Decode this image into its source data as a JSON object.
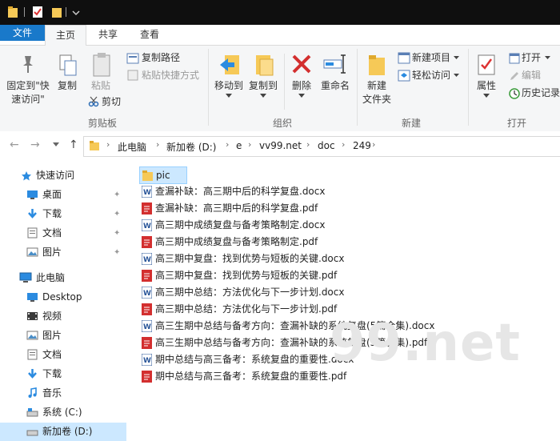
{
  "tabs": {
    "file": "文件",
    "home": "主页",
    "share": "共享",
    "view": "查看"
  },
  "ribbon": {
    "clipboard": {
      "pin_line1": "固定到\"快",
      "pin_line2": "速访问\"",
      "copy": "复制",
      "paste": "粘贴",
      "copy_path": "复制路径",
      "paste_shortcut": "粘贴快捷方式",
      "cut": "剪切",
      "label": "剪贴板"
    },
    "organize": {
      "move_to": "移动到",
      "copy_to": "复制到",
      "delete": "删除",
      "rename": "重命名",
      "label": "组织"
    },
    "new": {
      "new_folder_line1": "新建",
      "new_folder_line2": "文件夹",
      "new_item": "新建项目",
      "easy_access": "轻松访问",
      "label": "新建"
    },
    "open": {
      "properties": "属性",
      "open": "打开",
      "edit": "编辑",
      "history": "历史记录",
      "label": "打开"
    }
  },
  "breadcrumb": [
    "此电脑",
    "新加卷 (D:)",
    "e",
    "vv99.net",
    "doc",
    "249"
  ],
  "nav": {
    "quick_access": "快速访问",
    "items": [
      {
        "label": "桌面",
        "icon": "desktop-icon",
        "pinned": true
      },
      {
        "label": "下载",
        "icon": "download-icon",
        "pinned": true
      },
      {
        "label": "文档",
        "icon": "document-icon",
        "pinned": true
      },
      {
        "label": "图片",
        "icon": "picture-icon",
        "pinned": true
      }
    ],
    "this_pc": "此电脑",
    "pc_items": [
      {
        "label": "Desktop",
        "icon": "desktop-icon"
      },
      {
        "label": "视频",
        "icon": "video-icon"
      },
      {
        "label": "图片",
        "icon": "picture-icon"
      },
      {
        "label": "文档",
        "icon": "document-icon"
      },
      {
        "label": "下载",
        "icon": "download-icon"
      },
      {
        "label": "音乐",
        "icon": "music-icon"
      },
      {
        "label": "系统 (C:)",
        "icon": "drive-icon"
      },
      {
        "label": "新加卷 (D:)",
        "icon": "drive-icon"
      }
    ]
  },
  "files": [
    {
      "name": "pic",
      "type": "folder"
    },
    {
      "name": "查漏补缺：高三期中后的科学复盘.docx",
      "type": "docx"
    },
    {
      "name": "查漏补缺：高三期中后的科学复盘.pdf",
      "type": "pdf"
    },
    {
      "name": "高三期中成绩复盘与备考策略制定.docx",
      "type": "docx"
    },
    {
      "name": "高三期中成绩复盘与备考策略制定.pdf",
      "type": "pdf"
    },
    {
      "name": "高三期中复盘：找到优势与短板的关键.docx",
      "type": "docx"
    },
    {
      "name": "高三期中复盘：找到优势与短板的关键.pdf",
      "type": "pdf"
    },
    {
      "name": "高三期中总结：方法优化与下一步计划.docx",
      "type": "docx"
    },
    {
      "name": "高三期中总结：方法优化与下一步计划.pdf",
      "type": "pdf"
    },
    {
      "name": "高三生期中总结与备考方向：查漏补缺的系统复盘(5篇合集).docx",
      "type": "docx"
    },
    {
      "name": "高三生期中总结与备考方向：查漏补缺的系统复盘(5篇合集).pdf",
      "type": "pdf"
    },
    {
      "name": "期中总结与高三备考：系统复盘的重要性.docx",
      "type": "docx"
    },
    {
      "name": "期中总结与高三备考：系统复盘的重要性.pdf",
      "type": "pdf"
    }
  ],
  "watermark": "99.net",
  "colors": {
    "accent": "#1979ca",
    "folder": "#f6c957",
    "pdf": "#d32f2f",
    "word": "#2b579a",
    "selection": "#cce8ff"
  }
}
